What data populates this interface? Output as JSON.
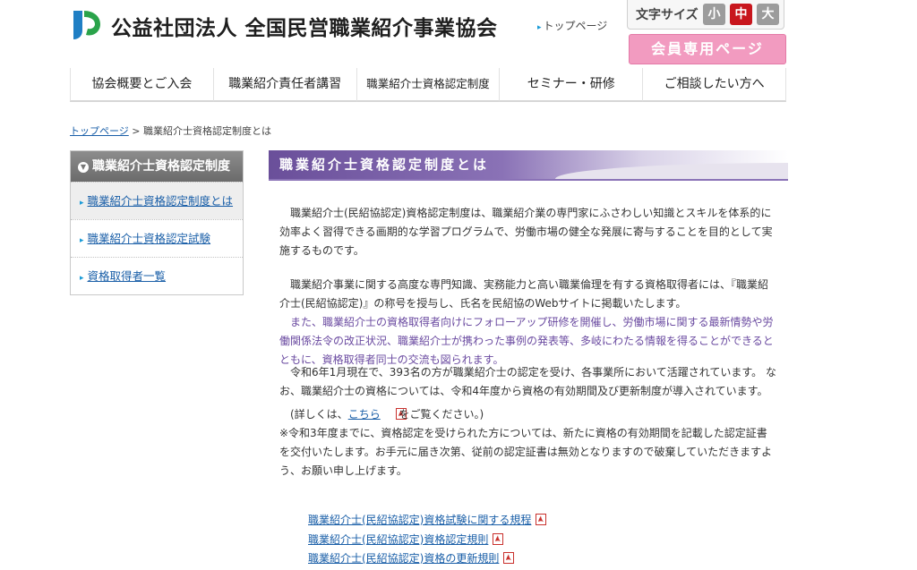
{
  "header": {
    "org_name": "公益社団法人 全国民営職業紹介事業協会",
    "top_link": "トップページ",
    "font_size_label": "文字サイズ",
    "font_size_small": "小",
    "font_size_medium": "中",
    "font_size_large": "大",
    "member_button": "会員専用ページ"
  },
  "nav": {
    "items": [
      "協会概要とご入会",
      "職業紹介責任者講習",
      "職業紹介士資格認定制度",
      "セミナー・研修",
      "ご相談したい方へ"
    ]
  },
  "breadcrumb": {
    "home": "トップページ",
    "separator": ">",
    "current": "職業紹介士資格認定制度とは"
  },
  "sidebar": {
    "heading": "職業紹介士資格認定制度",
    "items": [
      "職業紹介士資格認定制度とは",
      "職業紹介士資格認定試験",
      "資格取得者一覧"
    ]
  },
  "main": {
    "title": "職業紹介士資格認定制度とは",
    "p1": "職業紹介士(民紹協認定)資格認定制度は、職業紹介業の専門家にふさわしい知識とスキルを体系的に効率よく習得できる画期的な学習プログラムで、労働市場の健全な発展に寄与することを目的として実施するものです。",
    "p2": "職業紹介事業に関する高度な専門知識、実務能力と高い職業倫理を有する資格取得者には、『職業紹介士(民紹協認定)』の称号を授与し、氏名を民紹協のWebサイトに掲載いたします。",
    "p3": "また、職業紹介士の資格取得者向けにフォローアップ研修を開催し、労働市場に関する最新情勢や労働関係法令の改正状況、職業紹介士が携わった事例の発表等、多岐にわたる情報を得ることができるとともに、資格取得者同士の交流も図られます。",
    "p4": "令和6年1月現在で、393名の方が職業紹介士の認定を受け、各事業所において活躍されています。 なお、職業紹介士の資格については、令和4年度から資格の有効期間及び更新制度が導入されています。",
    "p5_before": "(詳しくは、",
    "p5_link": "こちら",
    "p5_after": "をご覧ください。)",
    "p6": "※令和3年度までに、資格認定を受けられた方については、新たに資格の有効期間を記載した認定証書を交付いたします。お手元に届き次第、従前の認定証書は無効となりますので破棄していただきますよう、お願い申し上げます。",
    "doc_links": [
      "職業紹介士(民紹協認定)資格試験に関する規程",
      "職業紹介士(民紹協認定)資格認定規則",
      "職業紹介士(民紹協認定)資格の更新規則"
    ]
  },
  "colors": {
    "accent_purple": "#6a4f9a",
    "member_pink": "#f29bc0",
    "font_medium_active": "#c8161d",
    "link_blue": "#1a5fa8"
  }
}
